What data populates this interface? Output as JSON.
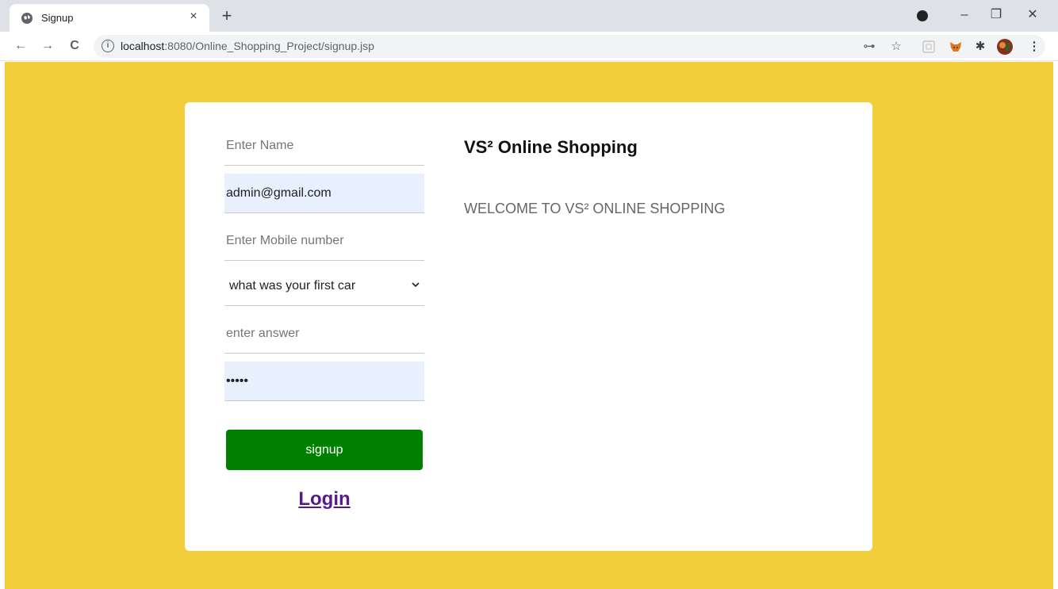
{
  "browser": {
    "tab_title": "Signup",
    "tab_close": "×",
    "new_tab": "+",
    "url_host": "localhost",
    "url_path": ":8080/Online_Shopping_Project/signup.jsp",
    "controls": {
      "minimize": "–",
      "restore": "❐",
      "close": "✕"
    },
    "nav": {
      "back": "←",
      "forward": "→",
      "reload": "C"
    },
    "toolbar_icons": {
      "key": "⊶",
      "star": "☆",
      "puzzle": "✱",
      "menu": "⋮"
    }
  },
  "form": {
    "name_placeholder": "Enter Name",
    "email_value": "admin@gmail.com",
    "mobile_placeholder": "Enter Mobile number",
    "security_question_selected": "what was your first car",
    "answer_placeholder": "enter answer",
    "password_value": "•••••",
    "signup_label": "signup",
    "login_label": "Login"
  },
  "info": {
    "title": "VS² Online Shopping",
    "welcome": "WELCOME TO VS² ONLINE SHOPPING"
  },
  "colors": {
    "page_background": "#f3ce3b",
    "signup_button": "#008000",
    "login_link": "#551a8b",
    "autofill": "#e8f0fe"
  }
}
